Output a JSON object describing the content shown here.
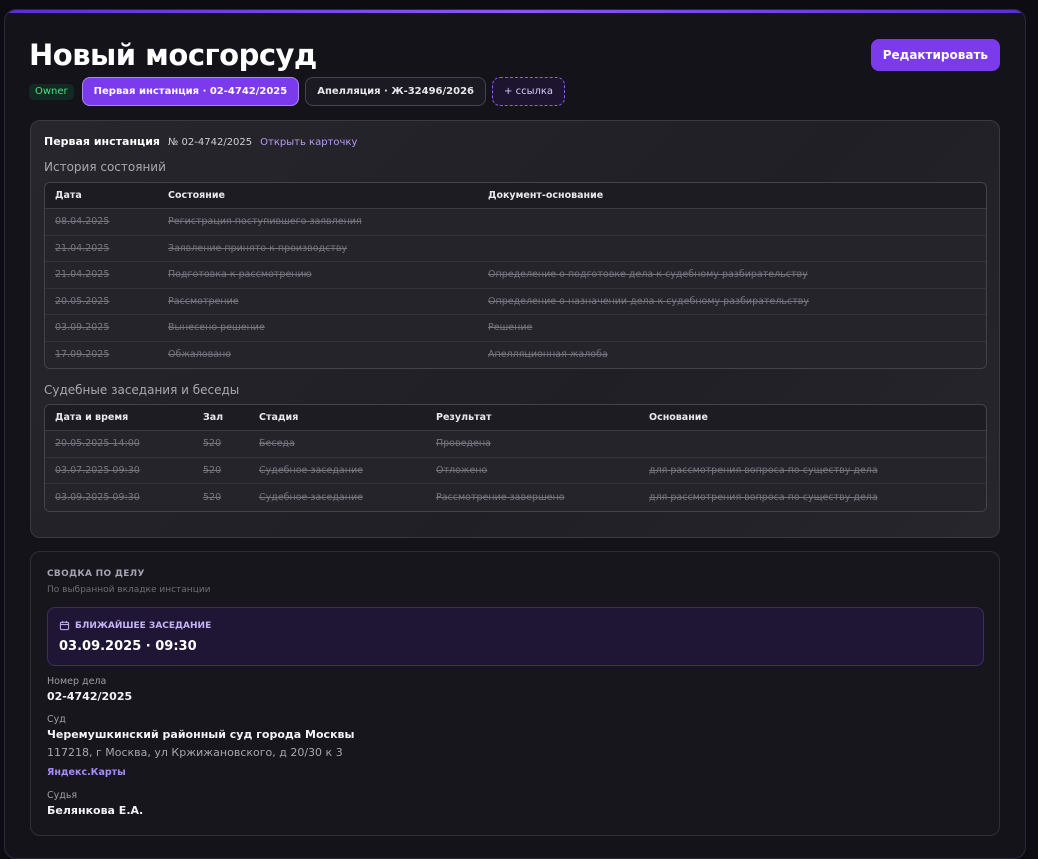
{
  "header": {
    "title": "Новый мосгорсуд",
    "edit_label": "Редактировать"
  },
  "tabs": {
    "owner_badge": "Owner",
    "items": [
      {
        "label": "Первая инстанция · 02-4742/2025",
        "active": true
      },
      {
        "label": "Апелляция · Ж-32496/2026",
        "active": false
      }
    ],
    "add_link": "+ ссылка"
  },
  "instance": {
    "heading": "Первая инстанция",
    "number": "№ 02-4742/2025",
    "open_card": "Открыть карточку"
  },
  "history": {
    "title": "История состояний",
    "columns": [
      "Дата",
      "Состояние",
      "Документ-основание"
    ],
    "rows": [
      [
        "08.04.2025",
        "Регистрация поступившего заявления",
        ""
      ],
      [
        "21.04.2025",
        "Заявление принято к производству",
        ""
      ],
      [
        "21.04.2025",
        "Подготовка к рассмотрению",
        "Определение о подготовке дела к судебному разбирательству"
      ],
      [
        "20.05.2025",
        "Рассмотрение",
        "Определение о назначении дела к судебному разбирательству"
      ],
      [
        "03.09.2025",
        "Вынесено решение",
        "Решение"
      ],
      [
        "17.09.2025",
        "Обжаловано",
        "Апелляционная жалоба"
      ]
    ]
  },
  "hearings": {
    "title": "Судебные заседания и беседы",
    "columns": [
      "Дата и время",
      "Зал",
      "Стадия",
      "Результат",
      "Основание"
    ],
    "rows": [
      [
        "20.05.2025 14:00",
        "520",
        "Беседа",
        "Проведена",
        ""
      ],
      [
        "03.07.2025 09:30",
        "520",
        "Судебное заседание",
        "Отложено",
        "для рассмотрения вопроса по существу дела"
      ],
      [
        "03.09.2025 09:30",
        "520",
        "Судебное заседание",
        "Рассмотрение завершено",
        "для рассмотрения вопроса по существу дела"
      ]
    ]
  },
  "summary": {
    "label": "СВОДКА ПО ДЕЛУ",
    "sub": "По выбранной вкладке инстанции",
    "next_label": "БЛИЖАЙШЕЕ ЗАСЕДАНИЕ",
    "next_value": "03.09.2025 · 09:30",
    "case_label": "Номер дела",
    "case_value": "02-4742/2025",
    "court_label": "Суд",
    "court_value": "Черемушкинский районный суд города Москвы",
    "court_address": "117218, г Москва, ул Кржижановского, д 20/30 к 3",
    "map_link": "Яндекс.Карты",
    "judge_label": "Судья",
    "judge_value": "Белянкова Е.А."
  },
  "colors": {
    "accent": "#7c3aed",
    "owner_badge": "#4ade80"
  }
}
